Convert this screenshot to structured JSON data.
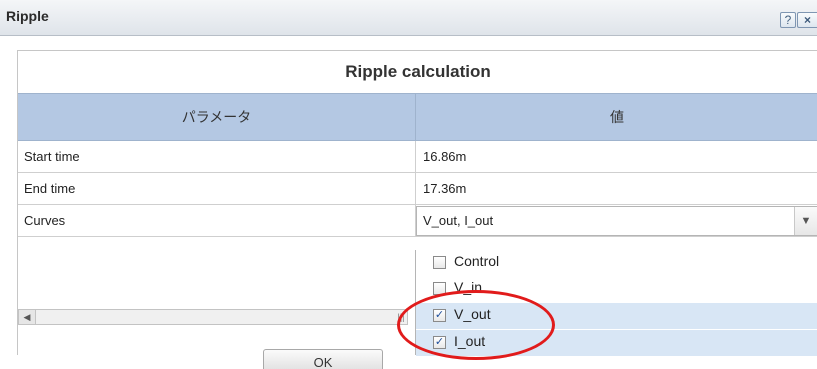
{
  "window": {
    "title": "Ripple",
    "help_label": "?",
    "close_label": "×"
  },
  "dialog": {
    "heading": "Ripple calculation"
  },
  "table": {
    "headers": {
      "param": "パラメータ",
      "value": "値"
    },
    "rows": [
      {
        "name": "Start time",
        "value": "16.86m"
      },
      {
        "name": "End time",
        "value": "17.36m"
      },
      {
        "name": "Curves",
        "value": "V_out, I_out"
      }
    ]
  },
  "curves_dropdown": {
    "options": [
      {
        "label": "Control",
        "checked": false
      },
      {
        "label": "V_in",
        "checked": false
      },
      {
        "label": "V_out",
        "checked": true
      },
      {
        "label": "I_out",
        "checked": true
      }
    ]
  },
  "footer": {
    "ok_label": "OK"
  },
  "colors": {
    "header_bg": "#b4c8e3",
    "selected_option_bg": "#d8e6f5",
    "highlight_ring": "#e11b1b"
  }
}
